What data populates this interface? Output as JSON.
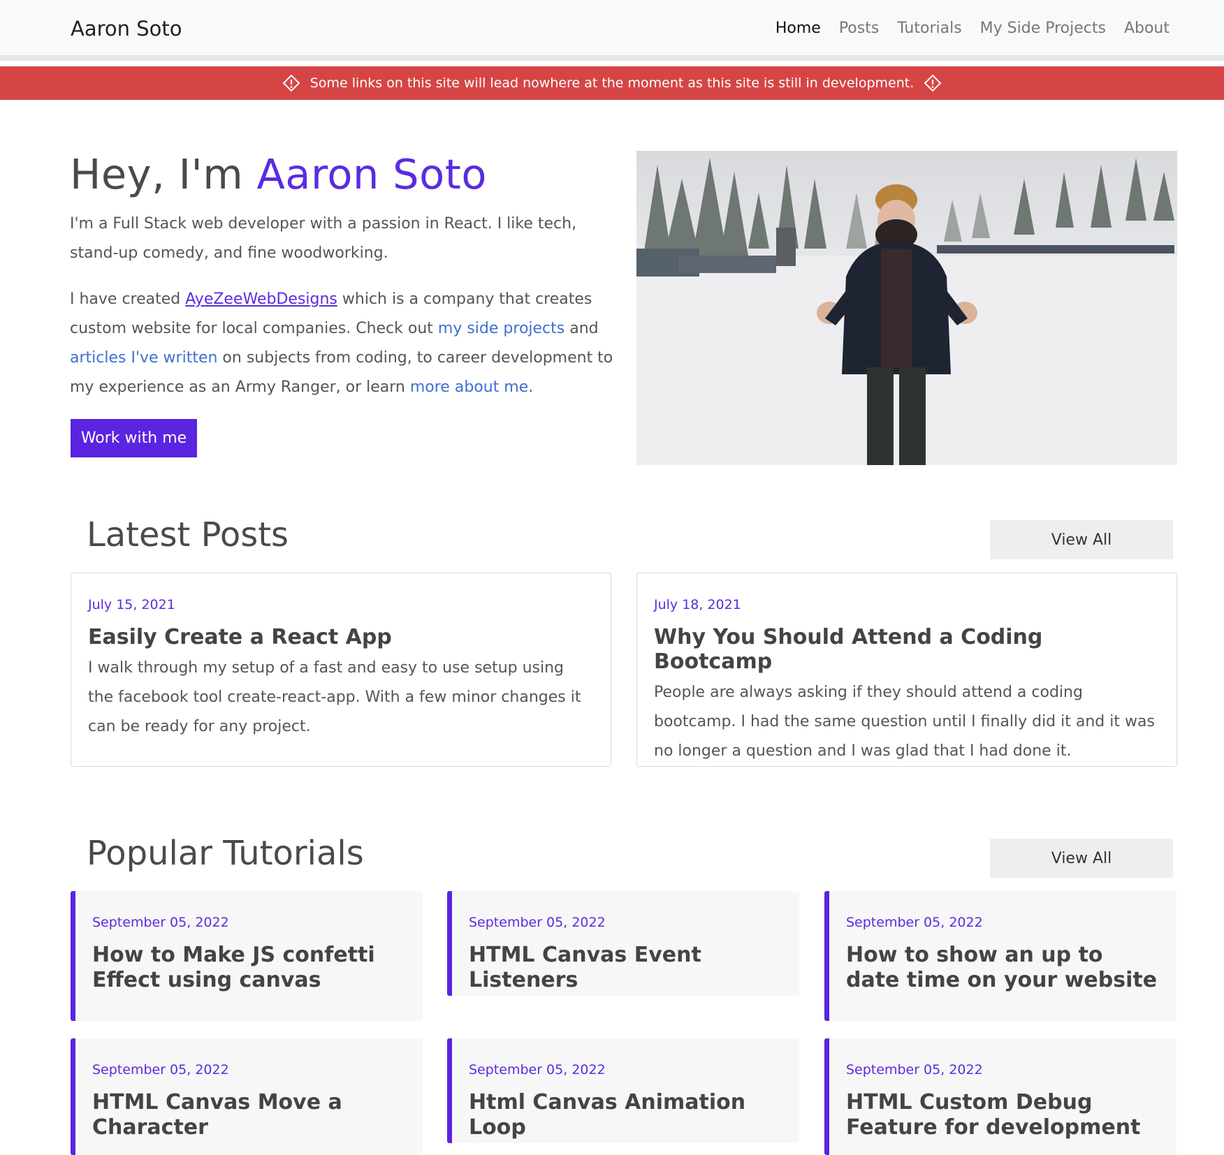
{
  "nav": {
    "brand": "Aaron Soto",
    "links": [
      "Home",
      "Posts",
      "Tutorials",
      "My Side Projects",
      "About"
    ]
  },
  "alert": {
    "text": "Some links on this site will lead nowhere at the moment as this site is still in development.",
    "icon": "warning-diamond-icon",
    "color": "#d64545"
  },
  "hero": {
    "title_prefix": "Hey, I'm ",
    "title_name": "Aaron Soto",
    "p1": "I'm a Full Stack web developer with a passion in React. I like tech, stand-up comedy, and fine woodworking.",
    "p2_a": "I have created ",
    "p2_link1": "AyeZeeWebDesigns",
    "p2_b": " which is a company that creates custom website for local companies. Check out ",
    "p2_link2": "my side projects",
    "p2_c": " and ",
    "p2_link3": "articles I've written",
    "p2_d": " on subjects from coding, to career development to my experience as an Army Ranger, or learn ",
    "p2_link4": "more about me",
    "p2_e": ".",
    "button": "Work with me",
    "accent": "#5b24e0"
  },
  "latest_posts": {
    "title": "Latest Posts",
    "view_all": "View All",
    "posts": [
      {
        "date": "July 15, 2021",
        "title": "Easily Create a React App",
        "excerpt": "I walk through my setup of a fast and easy to use setup using the facebook tool create-react-app. With a few minor changes it can be ready for any project."
      },
      {
        "date": "July 18, 2021",
        "title": "Why You Should Attend a Coding Bootcamp",
        "excerpt": "People are always asking if they should attend a coding bootcamp. I had the same question until I finally did it and it was no longer a question and I was glad that I had done it."
      }
    ]
  },
  "popular_tutorials": {
    "title": "Popular Tutorials",
    "view_all": "View All",
    "items": [
      {
        "date": "September 05, 2022",
        "title": "How to Make JS confetti Effect using canvas"
      },
      {
        "date": "September 05, 2022",
        "title": "HTML Canvas Event Listeners"
      },
      {
        "date": "September 05, 2022",
        "title": "How to show an up to date time on your website"
      },
      {
        "date": "September 05, 2022",
        "title": "HTML Canvas Move a Character"
      },
      {
        "date": "September 05, 2022",
        "title": "Html Canvas Animation Loop"
      },
      {
        "date": "September 05, 2022",
        "title": "HTML Custom Debug Feature for development"
      }
    ]
  }
}
